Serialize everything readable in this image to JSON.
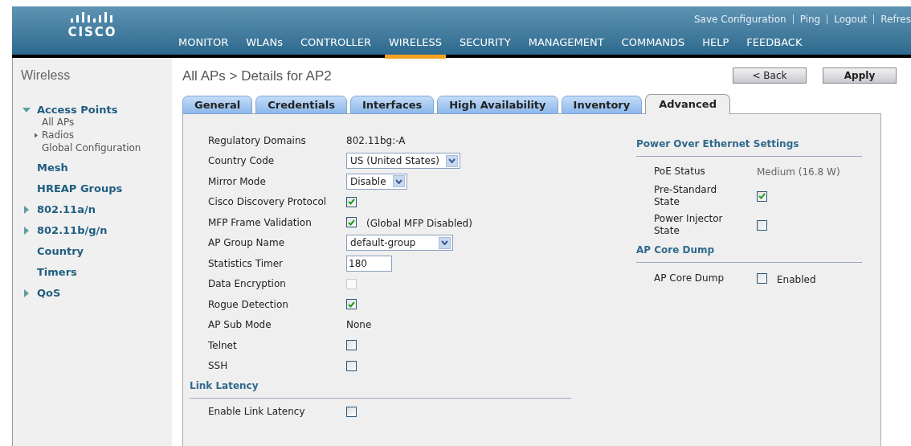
{
  "header": {
    "logo_text": "CISCO",
    "top_links": [
      "Save Configuration",
      "Ping",
      "Logout",
      "Refres"
    ],
    "nav": [
      {
        "label": "MONITOR",
        "selected": false
      },
      {
        "label": "WLANs",
        "selected": false
      },
      {
        "label": "CONTROLLER",
        "selected": false
      },
      {
        "label": "WIRELESS",
        "selected": true
      },
      {
        "label": "SECURITY",
        "selected": false
      },
      {
        "label": "MANAGEMENT",
        "selected": false
      },
      {
        "label": "COMMANDS",
        "selected": false
      },
      {
        "label": "HELP",
        "selected": false
      },
      {
        "label": "FEEDBACK",
        "selected": false
      }
    ]
  },
  "sidebar": {
    "title": "Wireless",
    "items": [
      {
        "label": "Access Points",
        "expanded": true,
        "children": [
          {
            "label": "All APs"
          },
          {
            "label": "Radios",
            "expandable": true
          },
          {
            "label": "Global Configuration"
          }
        ]
      },
      {
        "label": "Mesh",
        "expandable": false
      },
      {
        "label": "HREAP Groups",
        "expandable": false
      },
      {
        "label": "802.11a/n",
        "expandable": true
      },
      {
        "label": "802.11b/g/n",
        "expandable": true
      },
      {
        "label": "Country",
        "expandable": false
      },
      {
        "label": "Timers",
        "expandable": false
      },
      {
        "label": "QoS",
        "expandable": true
      }
    ]
  },
  "page": {
    "title": "All APs > Details for AP2",
    "buttons": [
      "< Back",
      "Apply"
    ]
  },
  "tabs": [
    {
      "label": "General",
      "selected": false
    },
    {
      "label": "Credentials",
      "selected": false
    },
    {
      "label": "Interfaces",
      "selected": false
    },
    {
      "label": "High Availability",
      "selected": false
    },
    {
      "label": "Inventory",
      "selected": false
    },
    {
      "label": "Advanced",
      "selected": true
    }
  ],
  "form": [
    {
      "kind": "text",
      "label": "Regulatory Domains",
      "value": "802.11bg:-A"
    },
    {
      "kind": "select",
      "label": "Country Code",
      "value": "US (United States)"
    },
    {
      "kind": "select",
      "label": "Mirror Mode",
      "value": "Disable"
    },
    {
      "kind": "checkbox",
      "label": "Cisco Discovery Protocol",
      "checked": true,
      "disabled": false
    },
    {
      "kind": "checkbox",
      "label": "MFP Frame Validation",
      "checked": true,
      "disabled": false,
      "note": "(Global MFP Disabled)"
    },
    {
      "kind": "select",
      "label": "AP Group Name",
      "value": "default-group"
    },
    {
      "kind": "input",
      "label": "Statistics Timer",
      "value": "180"
    },
    {
      "kind": "checkbox",
      "label": "Data Encryption",
      "checked": false,
      "disabled": true
    },
    {
      "kind": "checkbox",
      "label": "Rogue Detection",
      "checked": true,
      "disabled": false
    },
    {
      "kind": "text",
      "label": "AP Sub Mode",
      "value": "None"
    },
    {
      "kind": "checkbox",
      "label": "Telnet",
      "checked": false,
      "disabled": false
    },
    {
      "kind": "checkbox",
      "label": "SSH",
      "checked": false,
      "disabled": false
    }
  ],
  "link_latency": {
    "heading": "Link Latency",
    "rows": [
      {
        "kind": "checkbox",
        "label": "Enable Link Latency",
        "checked": false,
        "disabled": false
      }
    ]
  },
  "right_sections": [
    {
      "heading": "Power Over Ethernet Settings",
      "rows": [
        {
          "kind": "text",
          "label": "PoE Status",
          "value": "Medium (16.8 W)"
        },
        {
          "kind": "checkbox",
          "label": "Pre-Standard State",
          "checked": true,
          "disabled": false
        },
        {
          "kind": "checkbox",
          "label": "Power Injector State",
          "checked": false,
          "disabled": false
        }
      ]
    },
    {
      "heading": "AP Core Dump",
      "rows": [
        {
          "kind": "checkbox",
          "label": "AP Core Dump",
          "checked": false,
          "disabled": false,
          "note": "Enabled"
        }
      ]
    }
  ]
}
